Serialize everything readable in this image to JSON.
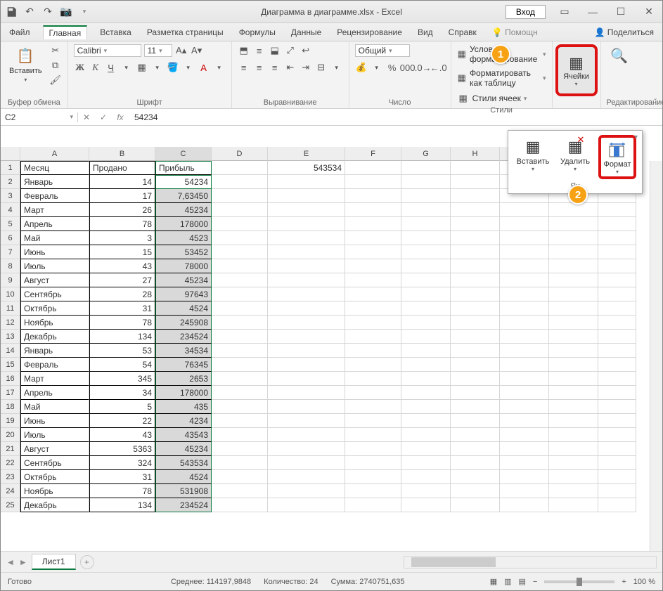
{
  "titlebar": {
    "title": "Диаграмма в диаграмме.xlsx - Excel",
    "login": "Вход"
  },
  "tabs": {
    "file": "Файл",
    "home": "Главная",
    "insert": "Вставка",
    "pagelayout": "Разметка страницы",
    "formulas": "Формулы",
    "data": "Данные",
    "review": "Рецензирование",
    "view": "Вид",
    "help": "Справк",
    "tellme": "Помощн",
    "share": "Поделиться"
  },
  "ribbon": {
    "paste": "Вставить",
    "clipboard_label": "Буфер обмена",
    "font_name": "Calibri",
    "font_size": "11",
    "font_label": "Шрифт",
    "align_label": "Выравнивание",
    "number_format": "Общий",
    "number_label": "Число",
    "cf": "Условное форматирование",
    "fmt_table": "Форматировать как таблицу",
    "cell_styles": "Стили ячеек",
    "styles_label": "Стили",
    "cells_btn": "Ячейки",
    "editing_label": "Редактирование"
  },
  "popup": {
    "insert": "Вставить",
    "delete": "Удалить",
    "format": "Формат",
    "label": "Яч"
  },
  "namebox": {
    "cell": "C2",
    "formula": "54234"
  },
  "columns": [
    "A",
    "B",
    "C",
    "D",
    "E",
    "F",
    "G",
    "H"
  ],
  "headers": {
    "A": "Месяц",
    "B": "Продано",
    "C": "Прибыль"
  },
  "other_cells": {
    "E1": "543534"
  },
  "rows": [
    {
      "n": 2,
      "m": "Январь",
      "b": "14",
      "c": "54234"
    },
    {
      "n": 3,
      "m": "Февраль",
      "b": "17",
      "c": "7,63450"
    },
    {
      "n": 4,
      "m": "Март",
      "b": "26",
      "c": "45234"
    },
    {
      "n": 5,
      "m": "Апрель",
      "b": "78",
      "c": "178000"
    },
    {
      "n": 6,
      "m": "Май",
      "b": "3",
      "c": "4523"
    },
    {
      "n": 7,
      "m": "Июнь",
      "b": "15",
      "c": "53452"
    },
    {
      "n": 8,
      "m": "Июль",
      "b": "43",
      "c": "78000"
    },
    {
      "n": 9,
      "m": "Август",
      "b": "27",
      "c": "45234"
    },
    {
      "n": 10,
      "m": "Сентябрь",
      "b": "28",
      "c": "97643"
    },
    {
      "n": 11,
      "m": "Октябрь",
      "b": "31",
      "c": "4524"
    },
    {
      "n": 12,
      "m": "Ноябрь",
      "b": "78",
      "c": "245908"
    },
    {
      "n": 13,
      "m": "Декабрь",
      "b": "134",
      "c": "234524"
    },
    {
      "n": 14,
      "m": "Январь",
      "b": "53",
      "c": "34534"
    },
    {
      "n": 15,
      "m": "Февраль",
      "b": "54",
      "c": "76345"
    },
    {
      "n": 16,
      "m": "Март",
      "b": "345",
      "c": "2653"
    },
    {
      "n": 17,
      "m": "Апрель",
      "b": "34",
      "c": "178000"
    },
    {
      "n": 18,
      "m": "Май",
      "b": "5",
      "c": "435"
    },
    {
      "n": 19,
      "m": "Июнь",
      "b": "22",
      "c": "4234"
    },
    {
      "n": 20,
      "m": "Июль",
      "b": "43",
      "c": "43543"
    },
    {
      "n": 21,
      "m": "Август",
      "b": "5363",
      "c": "45234"
    },
    {
      "n": 22,
      "m": "Сентябрь",
      "b": "324",
      "c": "543534"
    },
    {
      "n": 23,
      "m": "Октябрь",
      "b": "31",
      "c": "4524"
    },
    {
      "n": 24,
      "m": "Ноябрь",
      "b": "78",
      "c": "531908"
    },
    {
      "n": 25,
      "m": "Декабрь",
      "b": "134",
      "c": "234524"
    }
  ],
  "col_widths": {
    "rh": 28,
    "A": 98,
    "B": 94,
    "C": 80,
    "D": 80,
    "E": 110,
    "F": 80,
    "G": 70,
    "H": 70,
    "I": 70,
    "J": 70,
    "K": 54
  },
  "sheet": {
    "name": "Лист1"
  },
  "status": {
    "ready": "Готово",
    "avg": "Среднее: 114197,9848",
    "count": "Количество: 24",
    "sum": "Сумма: 2740751,635",
    "zoom": "100 %"
  },
  "callouts": {
    "c1": "1",
    "c2": "2"
  }
}
